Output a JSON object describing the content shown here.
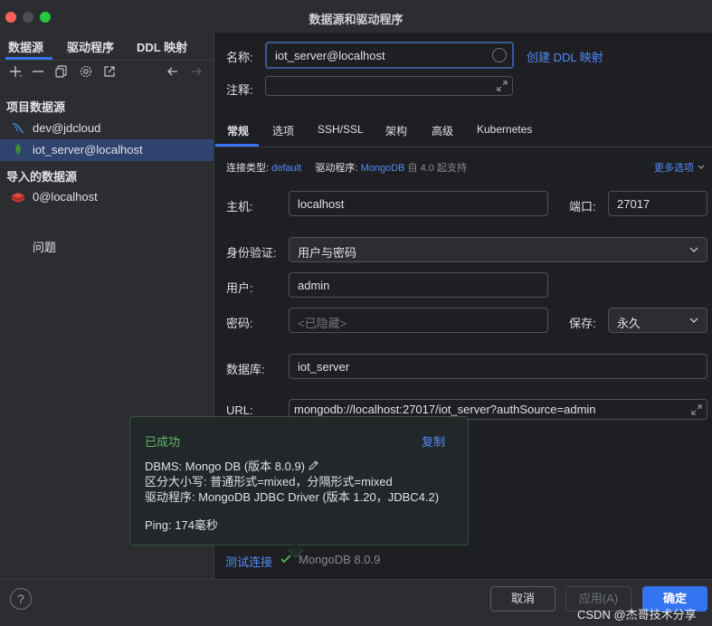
{
  "window": {
    "title": "数据源和驱动程序"
  },
  "sidebar": {
    "tabs": [
      "数据源",
      "驱动程序",
      "DDL 映射"
    ],
    "toolbar_icons": [
      "add-icon",
      "remove-icon",
      "duplicate-icon",
      "settings-icon",
      "open-external-icon",
      "back-arrow-icon",
      "forward-arrow-icon"
    ],
    "section_project": "项目数据源",
    "items": [
      {
        "label": "dev@jdcloud",
        "icon": "mysql-dolphin-icon",
        "selected": false
      },
      {
        "label": "iot_server@localhost",
        "icon": "mongodb-leaf-icon",
        "selected": true
      }
    ],
    "section_imported": "导入的数据源",
    "imported_items": [
      {
        "label": "0@localhost",
        "icon": "redis-icon"
      }
    ],
    "problems": "问题"
  },
  "form": {
    "name_label": "名称:",
    "name_value": "iot_server@localhost",
    "create_ddl_link": "创建 DDL 映射",
    "comment_label": "注释:",
    "comment_value": "",
    "tabs": [
      "常规",
      "选项",
      "SSH/SSL",
      "架构",
      "高级",
      "Kubernetes"
    ],
    "conn_type_key": "连接类型:",
    "conn_type_value": "default",
    "driver_key": "驱动程序:",
    "driver_value": "MongoDB",
    "driver_note": "自 4.0 起支持",
    "more_options": "更多选项",
    "host_label": "主机:",
    "host_value": "localhost",
    "port_label": "端口:",
    "port_value": "27017",
    "auth_label": "身份验证:",
    "auth_value": "用户与密码",
    "user_label": "用户:",
    "user_value": "admin",
    "password_label": "密码:",
    "password_placeholder": "<已隐藏>",
    "save_label": "保存:",
    "save_value": "永久",
    "database_label": "数据库:",
    "database_value": "iot_server",
    "url_label": "URL:",
    "url_value": "mongodb://localhost:27017/iot_server?authSource=admin"
  },
  "popup": {
    "status": "已成功",
    "copy": "复制",
    "dbms_line": "DBMS: Mongo DB (版本 8.0.9)",
    "case_line": "区分大小写: 普通形式=mixed，分隔形式=mixed",
    "driver_line": "驱动程序: MongoDB JDBC Driver (版本 1.20，JDBC4.2)",
    "ping_line": "Ping: 174毫秒"
  },
  "footer": {
    "test_connection": "测试连接",
    "test_result": "MongoDB 8.0.9"
  },
  "buttons": {
    "help": "?",
    "cancel": "取消",
    "apply": "应用(A)",
    "ok": "确定"
  },
  "watermark": "CSDN @杰哥技术分享",
  "colors": {
    "accent": "#3574f0",
    "link": "#548af7",
    "success": "#5fb865",
    "selected_row": "#2e436e"
  }
}
